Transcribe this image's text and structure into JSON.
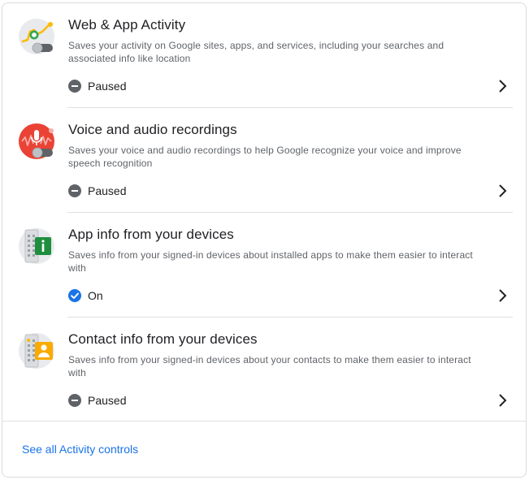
{
  "activity_items": [
    {
      "title": "Web & App Activity",
      "description": "Saves your activity on Google sites, apps, and services, including your searches and associated info like location",
      "status": "Paused",
      "status_type": "paused",
      "icon": "web-app-activity-icon"
    },
    {
      "title": "Voice and audio recordings",
      "description": "Saves your voice and audio recordings to help Google recognize your voice and improve speech recognition",
      "status": "Paused",
      "status_type": "paused",
      "icon": "voice-audio-icon"
    },
    {
      "title": "App info from your devices",
      "description": "Saves info from your signed-in devices about installed apps to make them easier to interact with",
      "status": "On",
      "status_type": "on",
      "icon": "app-info-icon"
    },
    {
      "title": "Contact info from your devices",
      "description": "Saves info from your signed-in devices about your contacts to make them easier to interact with",
      "status": "Paused",
      "status_type": "paused",
      "icon": "contact-info-icon"
    }
  ],
  "footer": {
    "link_label": "See all Activity controls"
  },
  "colors": {
    "paused": "#5f6368",
    "on": "#1a73e8",
    "link": "#1a73e8"
  }
}
